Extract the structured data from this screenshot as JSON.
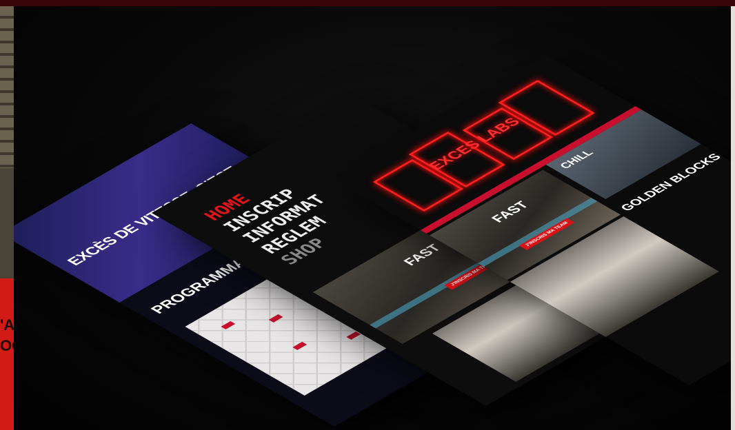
{
  "panel1": {
    "hero_title": "EXCÈS DE VITESSE, C'EST",
    "section_title": "PROGRAMMATION"
  },
  "panel2": {
    "nav": [
      "HOME",
      "INSCRIP",
      "INFORMAT",
      "REGLEM",
      "SHOP"
    ],
    "photo_label": "FAST",
    "button": "J'INSCRIS MA TEAM"
  },
  "panel3": {
    "neon_text": "EXCES LABS",
    "photo_label": "FAST",
    "chill_label": "CHILL",
    "button": "J'INSCRIS MA TEAM",
    "heading": "GOLDEN BLOCKS"
  },
  "colors": {
    "accent": "#d91218",
    "background": "#050505",
    "neon": "#ff2020"
  }
}
